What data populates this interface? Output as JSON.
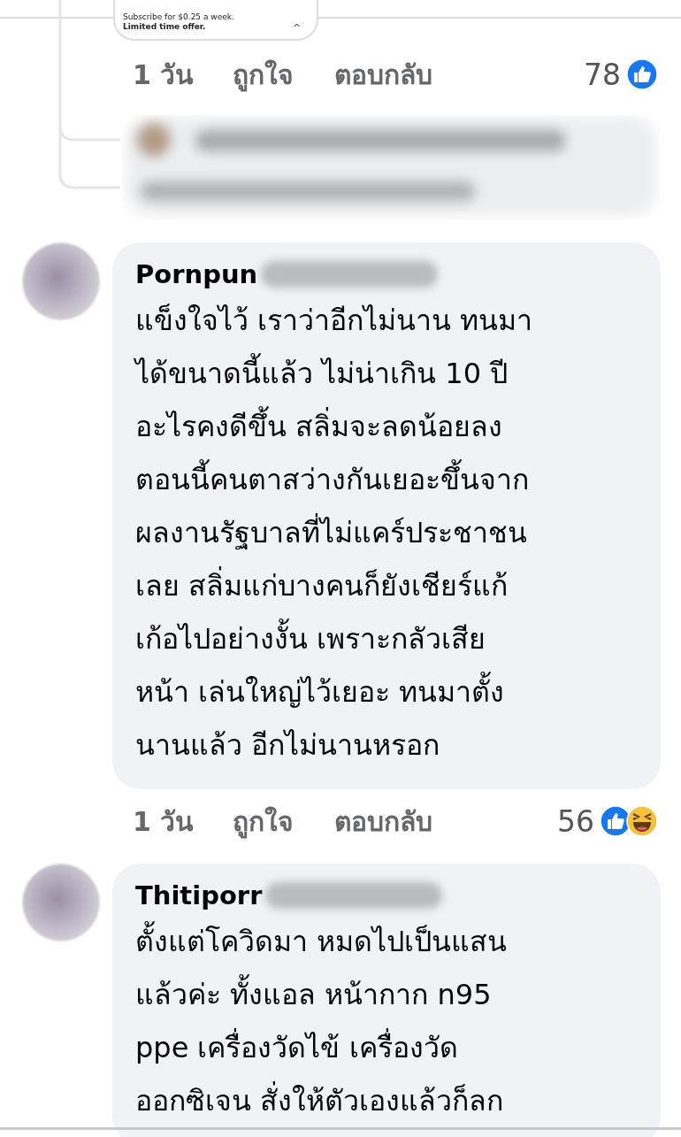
{
  "top_reply": {
    "ad_card": {
      "text": "Subscribe for $0.25 a week.",
      "bold_text": "Limited time offer.",
      "caret": "^"
    },
    "actions": {
      "time": "1 วัน",
      "like": "ถูกใจ",
      "reply": "ตอบกลับ",
      "reaction_count": "78",
      "reactions": [
        {
          "kind": "like"
        }
      ]
    }
  },
  "comments": [
    {
      "author": "Pornpun",
      "text": "แข็งใจไว้ เราว่าอีกไม่นาน ทนมา\nได้ขนาดนี้แล้ว ไม่น่าเกิน 10 ปี\nอะไรคงดีขึ้น สลิ่มจะลดน้อยลง\nตอนนี้คนตาสว่างกันเยอะขึ้นจาก\nผลงานรัฐบาลที่ไม่แคร์ประชาชน\nเลย สลิ่มแก่บางคนก็ยังเชียร์แก้\nเก้อไปอย่างงั้น เพราะกลัวเสีย\nหน้า เล่นใหญ่ไว้เยอะ ทนมาตั้ง\nนานแล้ว อีกไม่นานหรอก",
      "actions": {
        "time": "1 วัน",
        "like": "ถูกใจ",
        "reply": "ตอบกลับ",
        "reaction_count": "56",
        "reactions": [
          {
            "kind": "like"
          },
          {
            "kind": "haha"
          }
        ]
      }
    },
    {
      "author": "Thitiporr",
      "text": "ตั้งแต่โควิดมา หมดไปเป็นแสน\nแล้วค่ะ ทั้งแอล หน้ากาก n95\nppe เครื่องวัดไข้ เครื่องวัด\nออกซิเจน สั่งให้ตัวเองแล้วก็ลก"
    }
  ]
}
